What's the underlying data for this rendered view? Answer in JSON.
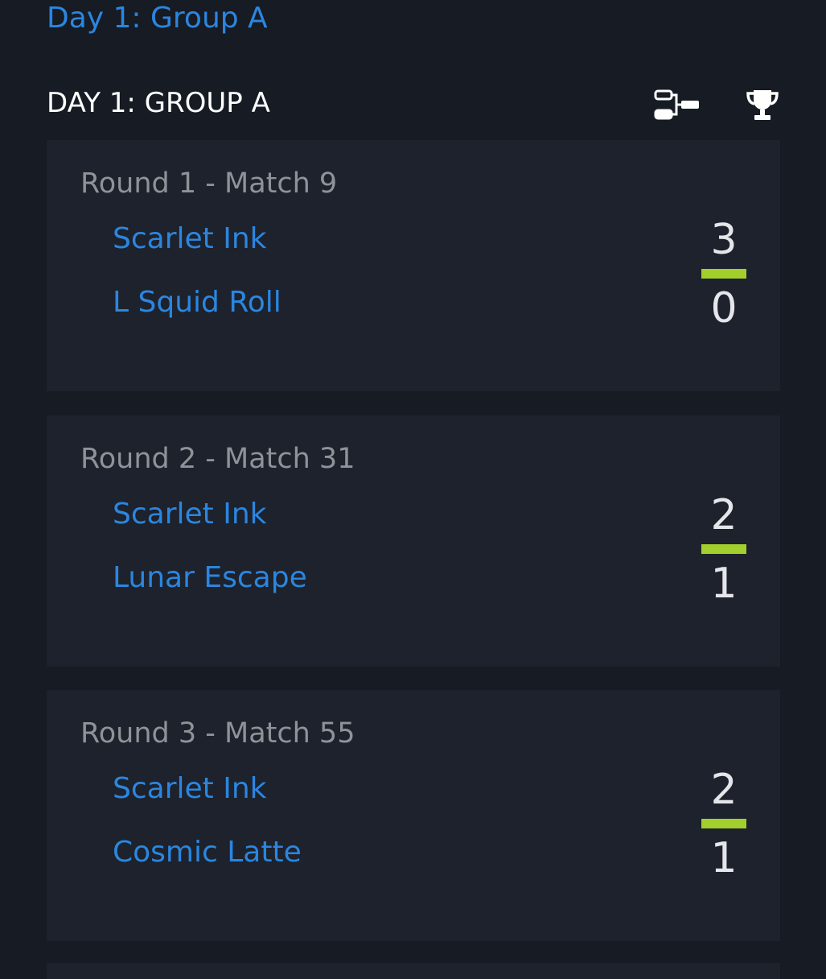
{
  "breadcrumb": {
    "link_label": "Day 1: Group A"
  },
  "section": {
    "title": "DAY 1: GROUP A",
    "icons": {
      "bracket": "bracket-icon",
      "trophy": "trophy-icon"
    }
  },
  "colors": {
    "background": "#161b24",
    "card": "#1d222c",
    "link": "#2b86e0",
    "score_bar": "#a3cf2c"
  },
  "matches": [
    {
      "title": "Round 1 - Match 9",
      "team1": "Scarlet Ink",
      "team2": "L Squid Roll",
      "score1": "3",
      "score2": "0"
    },
    {
      "title": "Round 2 - Match 31",
      "team1": "Scarlet Ink",
      "team2": "Lunar Escape",
      "score1": "2",
      "score2": "1"
    },
    {
      "title": "Round 3 - Match 55",
      "team1": "Scarlet Ink",
      "team2": "Cosmic Latte",
      "score1": "2",
      "score2": "1"
    }
  ]
}
